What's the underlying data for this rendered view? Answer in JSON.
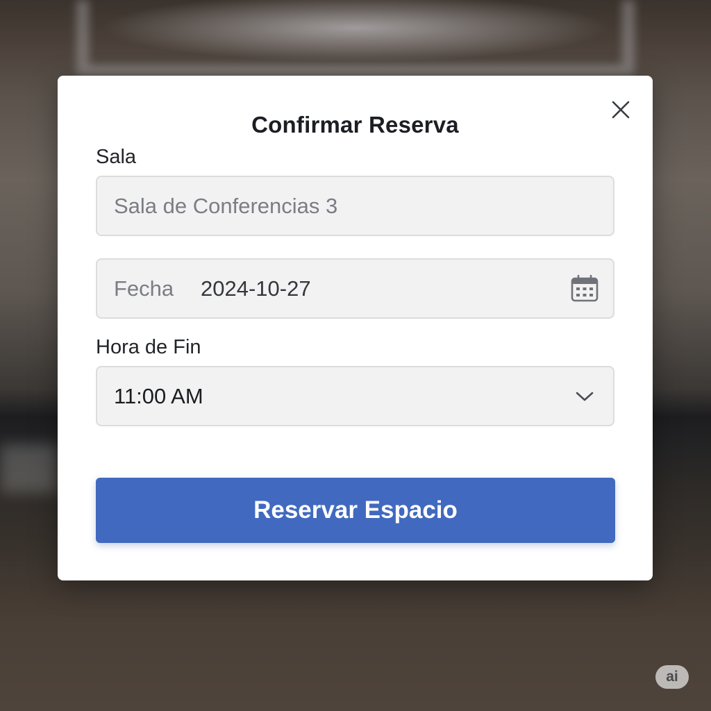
{
  "dialog": {
    "title": "Confirmar Reserva",
    "close_icon": "close-icon"
  },
  "form": {
    "room": {
      "label": "Sala",
      "placeholder": "Sala de Conferencias 3"
    },
    "date": {
      "label": "Fecha",
      "value": "2024-10-27",
      "icon": "calendar-icon"
    },
    "end_time": {
      "label": "Hora de Fin",
      "value": "11:00 AM",
      "icon": "chevron-down-icon"
    }
  },
  "actions": {
    "submit_label": "Reservar Espacio"
  },
  "badge": {
    "label": "ai"
  },
  "colors": {
    "primary_button": "#4169bf",
    "field_background": "#f2f2f3",
    "dialog_background": "#ffffff"
  }
}
